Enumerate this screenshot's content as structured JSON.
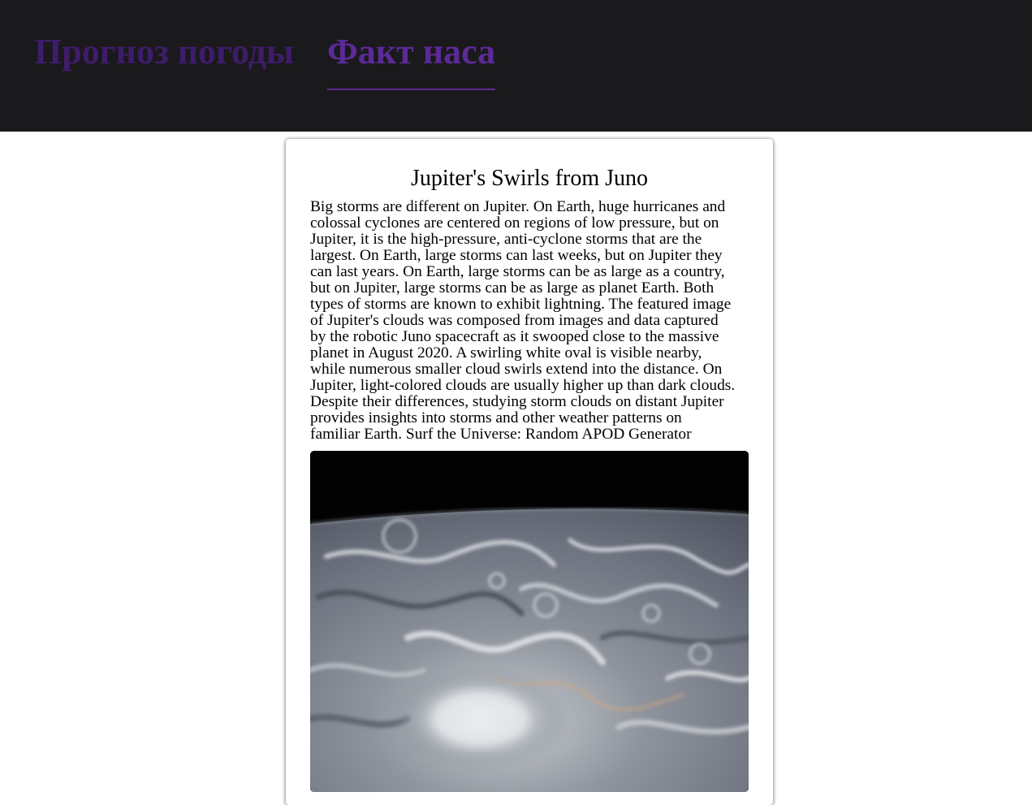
{
  "nav": {
    "tabs": [
      {
        "label": "Прогноз погоды",
        "active": false
      },
      {
        "label": "Факт наса",
        "active": true
      }
    ]
  },
  "apod": {
    "title": "Jupiter's Swirls from Juno",
    "explanation": "Big storms are different on Jupiter. On Earth, huge hurricanes and\ncolossal cyclones are centered on regions of low pressure, but on\nJupiter, it is the high-pressure, anti-cyclone storms that are the\nlargest. On Earth, large storms can last weeks, but on Jupiter they\ncan last years. On Earth, large storms can be as large as a country,\nbut on Jupiter, large storms can be as large as planet Earth. Both\ntypes of storms are known to exhibit lightning. The featured image\nof Jupiter's clouds was composed from images and data captured\nby the robotic Juno spacecraft as it swooped close to the massive\nplanet in August 2020.  A swirling white oval is visible nearby,\nwhile numerous smaller cloud swirls extend into the distance.  On\nJupiter, light-colored clouds are usually higher up than dark clouds.\nDespite their differences, studying storm clouds on distant Jupiter\nprovides insights into storms and other weather patterns on\nfamiliar Earth.  Surf the Universe: Random APOD Generator",
    "image": "jupiter-clouds-photo"
  },
  "colors": {
    "header_bg": "#1a191c",
    "tab_inactive": "#3e1c6b",
    "tab_active": "#5b2a97",
    "underline": "#5a2d8f"
  }
}
